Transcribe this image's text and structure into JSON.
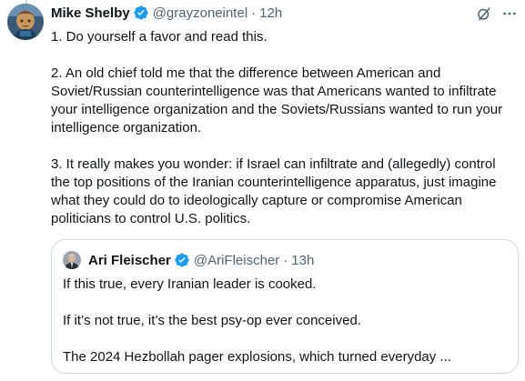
{
  "post": {
    "display_name": "Mike Shelby",
    "handle": "@grayzoneintel",
    "separator": "·",
    "time": "12h",
    "text": "1. Do yourself a favor and read this.\n\n2. An old chief told me that the difference between American and Soviet/Russian counterintelligence was that Americans wanted to infiltrate your intelligence organization and the Soviets/Russians wanted to run your intelligence organization.\n\n3. It really makes you wonder: if Israel can infiltrate and (allegedly) control the top positions of the Iranian counterintelligence apparatus, just imagine what they could do to ideologically capture or compromise American politicians to control U.S. politics."
  },
  "quote": {
    "display_name": "Ari Fleischer",
    "handle": "@AriFleischer",
    "separator": "·",
    "time": "13h",
    "text": "If this true, every Iranian leader is cooked.\n\nIf it’s not true, it’s the best psy-op ever conceived.\n\nThe 2024 Hezbollah pager explosions, which turned everyday ..."
  },
  "icons": {
    "verified": "verified-badge-icon",
    "grok": "grok-icon",
    "more": "more-icon"
  },
  "colors": {
    "text": "#0f1419",
    "secondary": "#536471",
    "verified": "#1d9bf0",
    "border": "#cfd9de"
  }
}
